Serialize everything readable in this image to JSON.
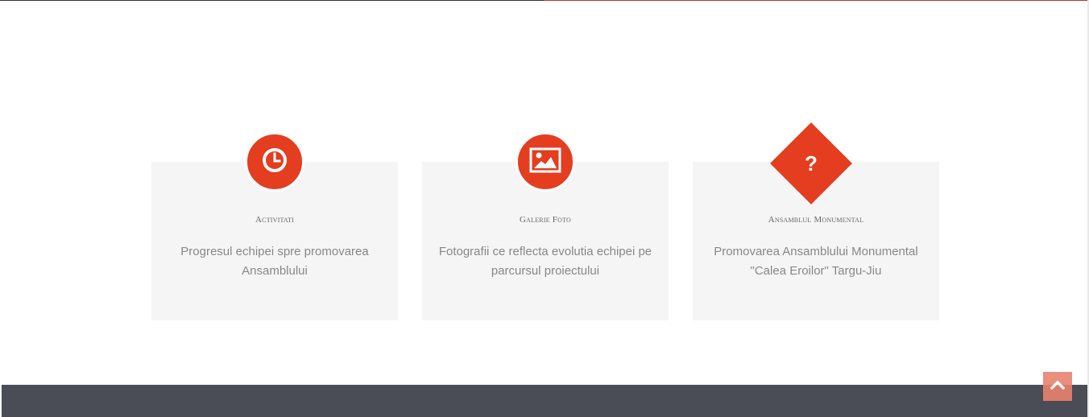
{
  "features": [
    {
      "icon": "clock-icon",
      "title": "Activitati",
      "description": "Progresul echipei spre promovarea Ansamblului"
    },
    {
      "icon": "image-icon",
      "title": "Galerie Foto",
      "description": "Fotografii ce reflecta evolutia echipei pe parcursul proiectului"
    },
    {
      "icon": "question-icon",
      "title": "Ansamblul Monumental",
      "description": "Promovarea Ansamblului Monumental \"Calea Eroilor\" Targu-Jiu",
      "glyph": "?"
    }
  ],
  "back_to_top": {
    "icon": "chevron-up-icon"
  },
  "colors": {
    "accent": "#e43d20",
    "card_bg": "#f5f5f5",
    "footer_bg": "#4a4d56",
    "back_to_top_bg": "#e8826f"
  }
}
